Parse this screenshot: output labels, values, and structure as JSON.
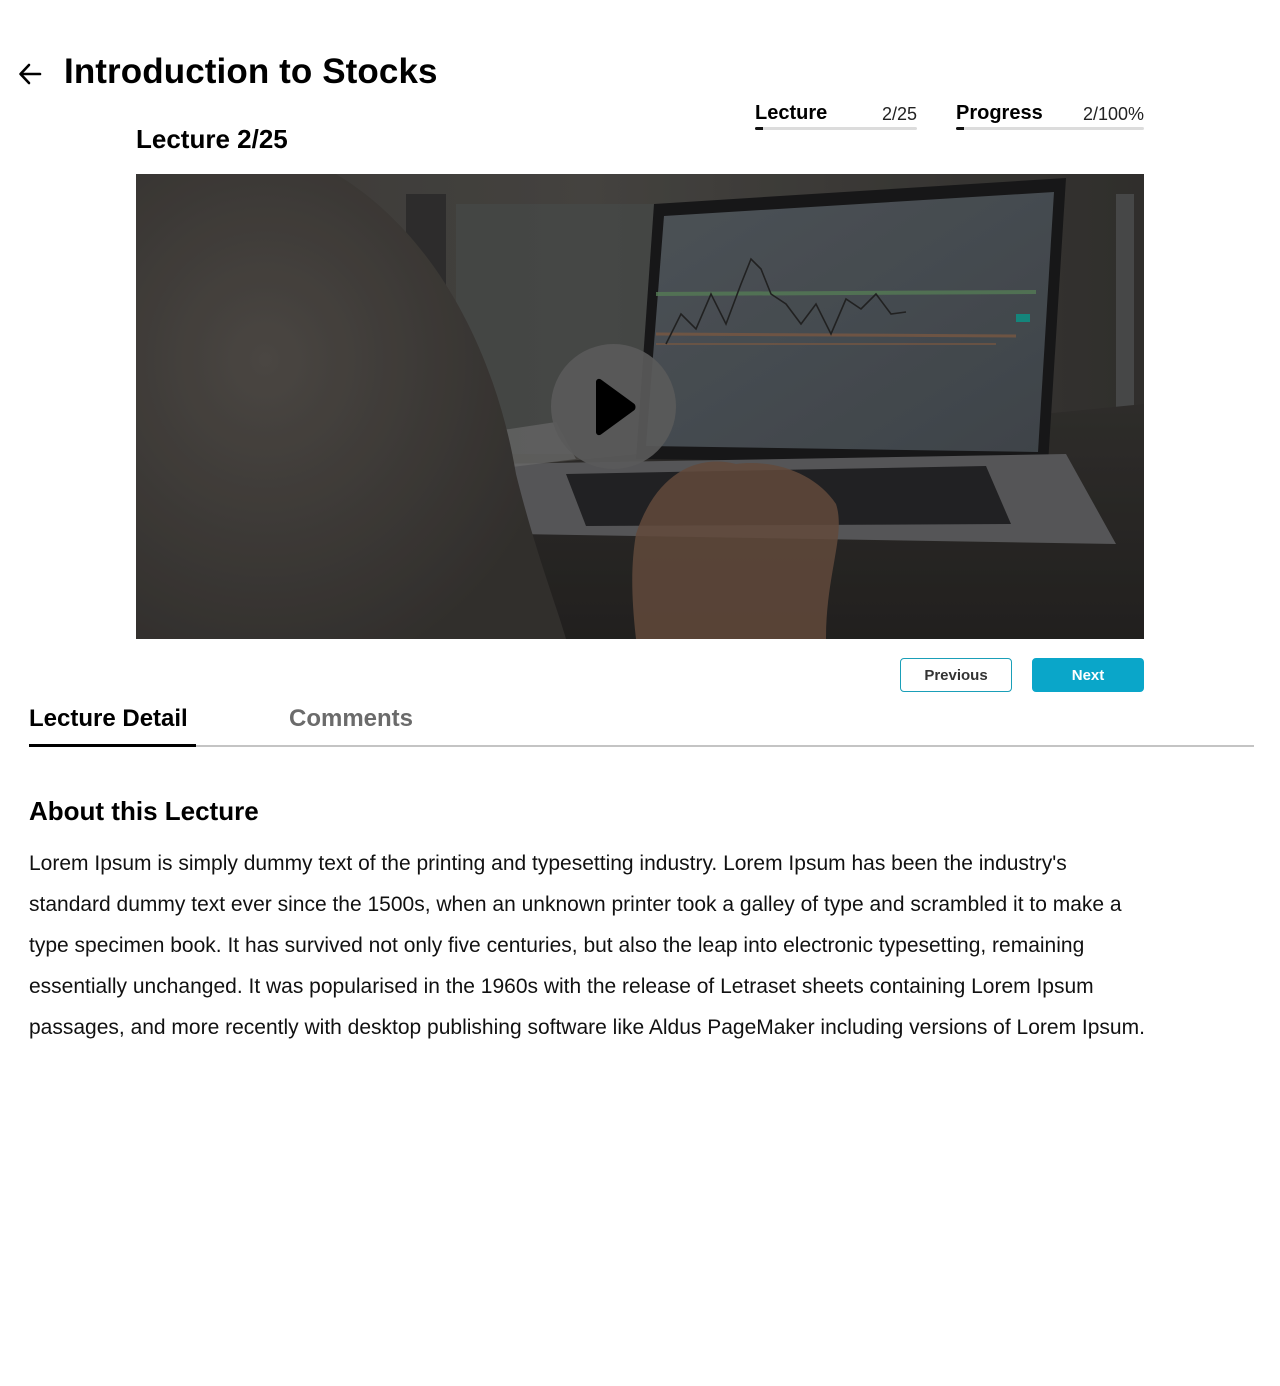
{
  "header": {
    "title": "Introduction to Stocks",
    "back_icon": "arrow-left-icon"
  },
  "stats": {
    "lecture": {
      "label": "Lecture",
      "value": "2/25",
      "fraction": 0.05
    },
    "progress": {
      "label": "Progress",
      "value": "2/100%",
      "fraction": 0.04
    }
  },
  "lecture": {
    "heading": "Lecture 2/25"
  },
  "video": {
    "play_icon": "play-icon"
  },
  "navigation": {
    "previous_label": "Previous",
    "next_label": "Next"
  },
  "tabs": [
    {
      "label": "Lecture Detail",
      "active": true
    },
    {
      "label": "Comments",
      "active": false
    }
  ],
  "about": {
    "title": "About this Lecture",
    "body": "Lorem Ipsum is simply dummy text of the printing and typesetting industry. Lorem Ipsum has been the industry's standard dummy text ever since the 1500s, when an unknown printer took a galley of type and scrambled it to make a type specimen book. It has survived not only five centuries, but also the leap into electronic typesetting, remaining essentially unchanged. It was popularised in the 1960s with the release of Letraset sheets containing Lorem Ipsum passages, and more recently with desktop publishing software like Aldus PageMaker including versions of Lorem Ipsum."
  },
  "colors": {
    "accent": "#0aa6c9",
    "text": "#000000",
    "muted_tab": "#6b6b6b",
    "divider": "#c4c4c4"
  }
}
